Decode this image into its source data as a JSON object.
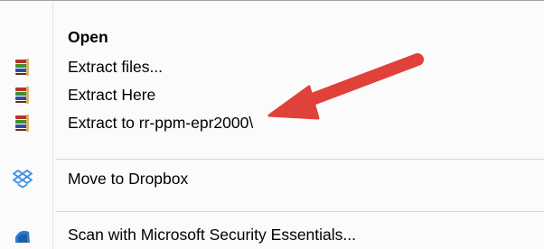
{
  "menu": {
    "items": [
      {
        "label": "Open",
        "icon": null
      },
      {
        "label": "Extract files...",
        "icon": "winrar-books-icon"
      },
      {
        "label": "Extract Here",
        "icon": "winrar-books-icon"
      },
      {
        "label": "Extract to rr-ppm-epr2000\\",
        "icon": "winrar-books-icon"
      },
      {
        "label": "Move to Dropbox",
        "icon": "dropbox-icon"
      },
      {
        "label": "Scan with Microsoft Security Essentials...",
        "icon": "security-essentials-icon"
      }
    ]
  },
  "annotation": {
    "arrow_color": "#e0413a"
  },
  "colors": {
    "winrar_red": "#b8322c",
    "winrar_green": "#3f8f2f",
    "winrar_blue": "#2d4fa3",
    "dropbox_blue": "#3d8fe0"
  }
}
